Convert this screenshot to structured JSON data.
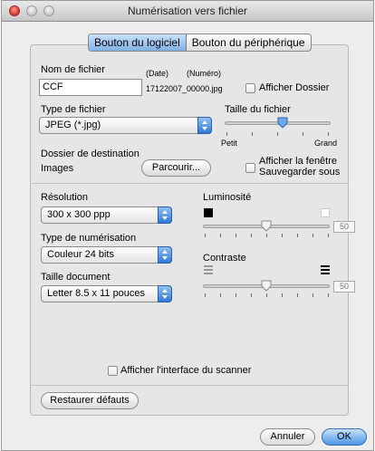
{
  "window": {
    "title": "Numérisation vers fichier"
  },
  "tabs": {
    "software": "Bouton du logiciel",
    "device": "Bouton du périphérique"
  },
  "file": {
    "name_label": "Nom de fichier",
    "name_value": "CCF",
    "date_label": "(Date)",
    "number_label": "(Numéro)",
    "generated_name": "17122007_00000.jpg",
    "show_folder_label": "Afficher Dossier",
    "type_label": "Type de fichier",
    "type_value": "JPEG (*.jpg)",
    "size_label": "Taille du fichier",
    "size_min": "Petit",
    "size_max": "Grand",
    "size_level": 0.55,
    "dest_label": "Dossier de destination",
    "dest_value": "Images",
    "browse": "Parcourir...",
    "show_save_as": "Afficher la fenêtre\nSauvegarder sous"
  },
  "scan": {
    "resolution_label": "Résolution",
    "resolution_value": "300 x 300 ppp",
    "scan_type_label": "Type de numérisation",
    "scan_type_value": "Couleur 24 bits",
    "doc_size_label": "Taille document",
    "doc_size_value": "Letter  8.5 x 11 pouces",
    "brightness_label": "Luminosité",
    "brightness_value": "50",
    "contrast_label": "Contraste",
    "contrast_value": "50",
    "show_scanner_ui": "Afficher l'interface du scanner"
  },
  "buttons": {
    "restore": "Restaurer défauts",
    "cancel": "Annuler",
    "ok": "OK"
  },
  "colors": {
    "accent": "#4c97e8"
  }
}
